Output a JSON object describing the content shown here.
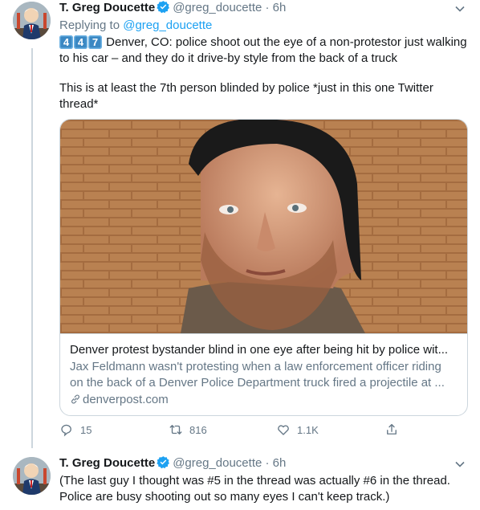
{
  "tweets": [
    {
      "display_name": "T. Greg Doucette",
      "handle": "@greg_doucette",
      "separator": "·",
      "time": "6h",
      "replying_prefix": "Replying to",
      "replying_to": "@greg_doucette",
      "keycaps": [
        "4",
        "4",
        "7"
      ],
      "text_line1": " Denver, CO: police shoot out the eye of a non-protestor just walking to his car – and they do it drive-by style from the back of a truck",
      "text_line2": "This is at least the 7th person blinded by police *just in this one Twitter thread*",
      "card": {
        "title": "Denver protest bystander blind in one eye after being hit by police wit...",
        "description": "Jax Feldmann wasn't protesting when a law enforcement officer riding on the back of a Denver Police Department truck fired a projectile at ...",
        "domain": "denverpost.com"
      },
      "actions": {
        "replies": "15",
        "retweets": "816",
        "likes": "1.1K"
      }
    },
    {
      "display_name": "T. Greg Doucette",
      "handle": "@greg_doucette",
      "separator": "·",
      "time": "6h",
      "text": "(The last guy I thought was #5 in the thread was actually #6 in the thread. Police are busy shooting out so many eyes I can't keep track.)"
    }
  ],
  "colors": {
    "accent": "#1da1f2",
    "muted": "#657786",
    "border": "#ccd6dd"
  }
}
